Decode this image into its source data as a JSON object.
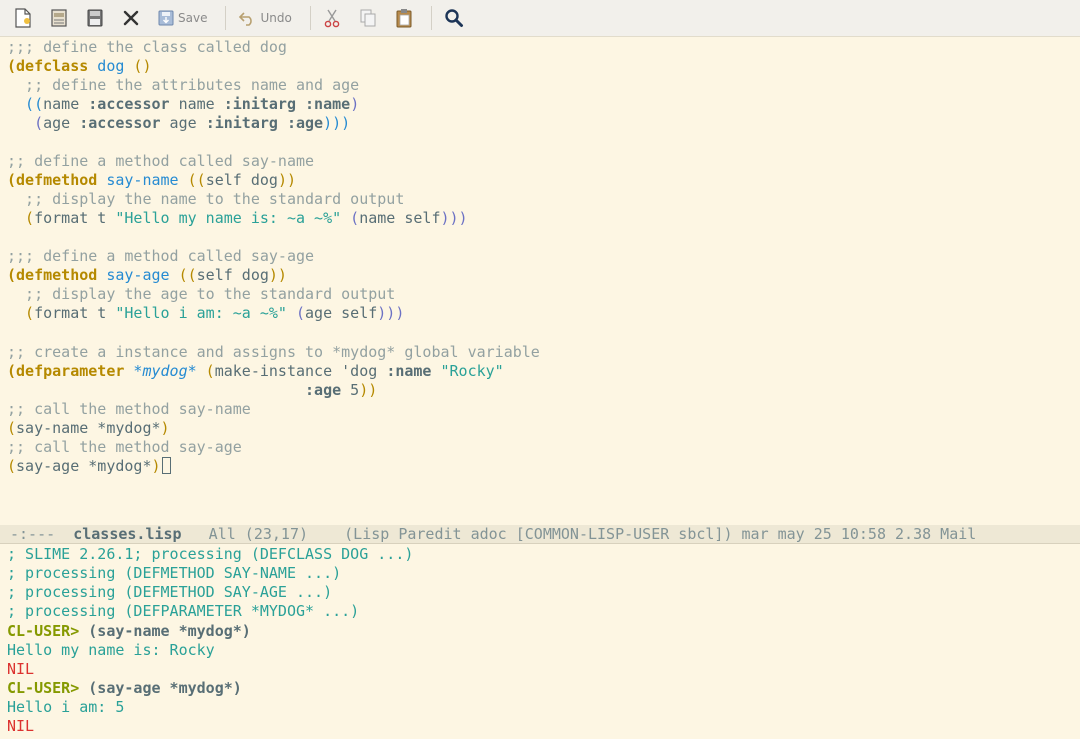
{
  "toolbar": {
    "new_icon": "new-file-icon",
    "open_icon": "open-folder-icon",
    "save_disk_icon": "floppy-icon",
    "close_icon": "close-icon",
    "save_label": "Save",
    "undo_label": "Undo",
    "cut_icon": "scissors-icon",
    "copy_icon": "copy-icon",
    "paste_icon": "paste-icon",
    "search_icon": "search-icon"
  },
  "editor": {
    "l1": ";;; define the class called dog",
    "l2_kw": "(defclass",
    "l2_name": " dog",
    "l2_rest": " ()",
    "l3": "  ;; define the attributes name and age",
    "l4_a": "  ((",
    "l4_b": "name ",
    "l4_c": ":accessor",
    "l4_d": " name ",
    "l4_e": ":initarg",
    "l4_f": " ",
    "l4_g": ":name",
    "l4_h": ")",
    "l5_a": "   (",
    "l5_b": "age ",
    "l5_c": ":accessor",
    "l5_d": " age ",
    "l5_e": ":initarg",
    "l5_f": " ",
    "l5_g": ":age",
    "l5_h": ")))",
    "l7": ";; define a method called say-name",
    "l8_kw": "(defmethod",
    "l8_name": " say-name",
    "l8_a": " ((",
    "l8_b": "self dog",
    "l8_c": "))",
    "l9": "  ;; display the name to the standard output",
    "l10_a": "  (",
    "l10_b": "format t ",
    "l10_s": "\"Hello my name is: ~a ~%\"",
    "l10_c": " (",
    "l10_d": "name self",
    "l10_e": ")))",
    "l12": ";;; define a method called say-age",
    "l13_kw": "(defmethod",
    "l13_name": " say-age",
    "l13_a": " ((",
    "l13_b": "self dog",
    "l13_c": "))",
    "l14": "  ;; display the age to the standard output",
    "l15_a": "  (",
    "l15_b": "format t ",
    "l15_s": "\"Hello i am: ~a ~%\"",
    "l15_c": " (",
    "l15_d": "age self",
    "l15_e": ")))",
    "l17": ";; create a instance and assigns to *mydog* global variable",
    "l18_kw": "(defparameter",
    "l18_v": " *mydog*",
    "l18_a": " (",
    "l18_b": "make-instance 'dog ",
    "l18_c": ":name",
    "l18_s": " \"Rocky\"",
    "l19_pad": "                                 ",
    "l19_c": ":age",
    "l19_d": " 5",
    "l19_e": "))",
    "l20": ";; call the method say-name",
    "l21_a": "(",
    "l21_b": "say-name *mydog*",
    "l21_c": ")",
    "l22": ";; call the method say-age",
    "l23_a": "(",
    "l23_b": "say-age *mydog*",
    "l23_c": ")"
  },
  "modeline": {
    "status": "-:---  ",
    "buffer": "classes.lisp",
    "rest": "   All (23,17)    (Lisp Paredit adoc [COMMON-LISP-USER sbcl]) mar may 25 10:58 2.38 Mail"
  },
  "repl": {
    "r1": "; SLIME 2.26.1; processing (DEFCLASS DOG ...)",
    "r2": "; processing (DEFMETHOD SAY-NAME ...)",
    "r3": "; processing (DEFMETHOD SAY-AGE ...)",
    "r4": "; processing (DEFPARAMETER *MYDOG* ...)",
    "prompt": "CL-USER>",
    "in1": " (say-name *mydog*)",
    "out1": "Hello my name is: Rocky",
    "nil1": "NIL",
    "in2": " (say-age *mydog*)",
    "out2": "Hello i am: 5",
    "nil2": "NIL"
  },
  "colors": {
    "background": "#fdf6e3",
    "comment": "#93a1a1",
    "keyword": "#859900",
    "function": "#268bd2",
    "string": "#2aa198",
    "error": "#dc322f"
  }
}
